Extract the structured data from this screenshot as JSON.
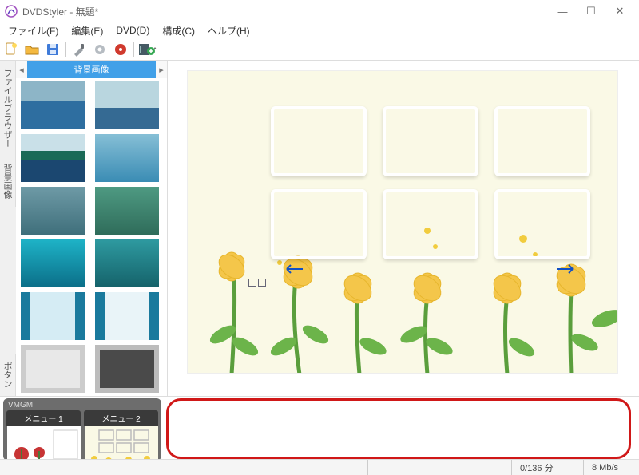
{
  "title": "DVDStyler - 無題*",
  "menus": [
    "ファイル(F)",
    "編集(E)",
    "DVD(D)",
    "構成(C)",
    "ヘルプ(H)"
  ],
  "toolbar_icons": [
    "new",
    "open",
    "save",
    "tools",
    "settings",
    "burn",
    "add-file"
  ],
  "side_tabs": [
    "ファイルブラウザー",
    "背景画像",
    "ボタン"
  ],
  "side_tabs_active": 1,
  "thumb_panel_title": "背景画像",
  "bottom": {
    "group_title": "VMGM",
    "menu1_label": "メニュー 1",
    "menu2_label": "メニュー 2"
  },
  "status": {
    "duration": "0/136 分",
    "bitrate": "8 Mb/s"
  },
  "window_controls": {
    "min": "—",
    "max": "☐",
    "close": "✕"
  }
}
